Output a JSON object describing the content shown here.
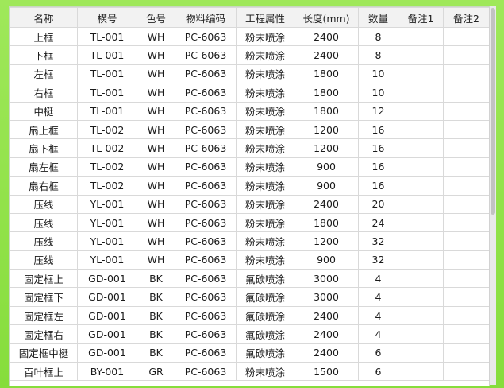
{
  "table": {
    "headers": [
      "名称",
      "横号",
      "色号",
      "物料编码",
      "工程属性",
      "长度(mm)",
      "数量",
      "备注1",
      "备注2"
    ],
    "rows": [
      [
        "上框",
        "TL-001",
        "WH",
        "PC-6063",
        "粉末喷涂",
        "2400",
        "8",
        "",
        ""
      ],
      [
        "下框",
        "TL-001",
        "WH",
        "PC-6063",
        "粉末喷涂",
        "2400",
        "8",
        "",
        ""
      ],
      [
        "左框",
        "TL-001",
        "WH",
        "PC-6063",
        "粉末喷涂",
        "1800",
        "10",
        "",
        ""
      ],
      [
        "右框",
        "TL-001",
        "WH",
        "PC-6063",
        "粉末喷涂",
        "1800",
        "10",
        "",
        ""
      ],
      [
        "中梃",
        "TL-001",
        "WH",
        "PC-6063",
        "粉末喷涂",
        "1800",
        "12",
        "",
        ""
      ],
      [
        "扇上框",
        "TL-002",
        "WH",
        "PC-6063",
        "粉末喷涂",
        "1200",
        "16",
        "",
        ""
      ],
      [
        "扇下框",
        "TL-002",
        "WH",
        "PC-6063",
        "粉末喷涂",
        "1200",
        "16",
        "",
        ""
      ],
      [
        "扇左框",
        "TL-002",
        "WH",
        "PC-6063",
        "粉末喷涂",
        "900",
        "16",
        "",
        ""
      ],
      [
        "扇右框",
        "TL-002",
        "WH",
        "PC-6063",
        "粉末喷涂",
        "900",
        "16",
        "",
        ""
      ],
      [
        "压线",
        "YL-001",
        "WH",
        "PC-6063",
        "粉末喷涂",
        "2400",
        "20",
        "",
        ""
      ],
      [
        "压线",
        "YL-001",
        "WH",
        "PC-6063",
        "粉末喷涂",
        "1800",
        "24",
        "",
        ""
      ],
      [
        "压线",
        "YL-001",
        "WH",
        "PC-6063",
        "粉末喷涂",
        "1200",
        "32",
        "",
        ""
      ],
      [
        "压线",
        "YL-001",
        "WH",
        "PC-6063",
        "粉末喷涂",
        "900",
        "32",
        "",
        ""
      ],
      [
        "固定框上",
        "GD-001",
        "BK",
        "PC-6063",
        "氟碳喷涂",
        "3000",
        "4",
        "",
        ""
      ],
      [
        "固定框下",
        "GD-001",
        "BK",
        "PC-6063",
        "氟碳喷涂",
        "3000",
        "4",
        "",
        ""
      ],
      [
        "固定框左",
        "GD-001",
        "BK",
        "PC-6063",
        "氟碳喷涂",
        "2400",
        "4",
        "",
        ""
      ],
      [
        "固定框右",
        "GD-001",
        "BK",
        "PC-6063",
        "氟碳喷涂",
        "2400",
        "4",
        "",
        ""
      ],
      [
        "固定框中梃",
        "GD-001",
        "BK",
        "PC-6063",
        "氟碳喷涂",
        "2400",
        "6",
        "",
        ""
      ],
      [
        "百叶框上",
        "BY-001",
        "GR",
        "PC-6063",
        "粉末喷涂",
        "1500",
        "6",
        "",
        ""
      ]
    ]
  },
  "scroll": {
    "position_fraction": 0.0,
    "visible_fraction": 0.55
  },
  "colors": {
    "background": "#8fe04a",
    "header_bg": "#f2f2f2",
    "grid": "#d9d9d9"
  }
}
